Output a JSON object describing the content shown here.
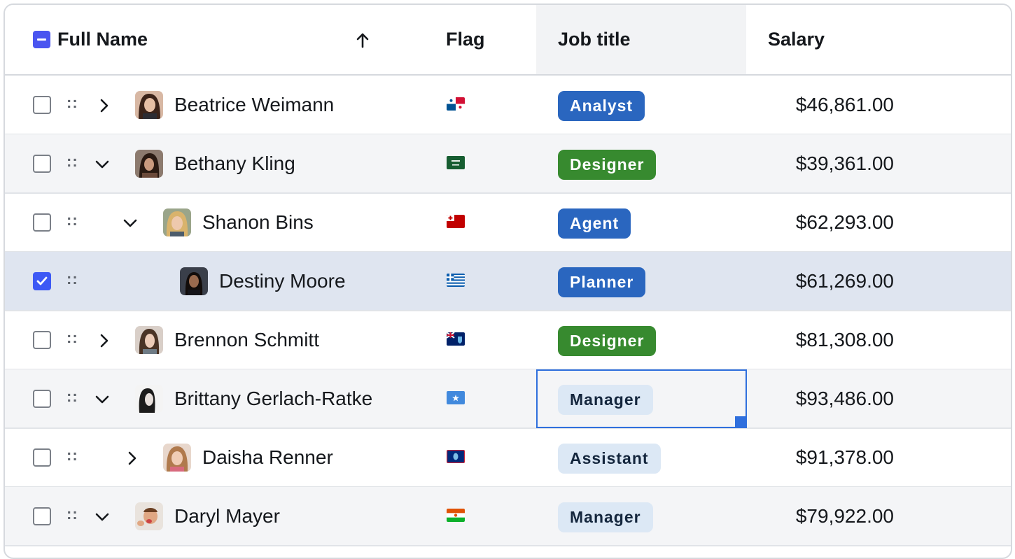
{
  "columns": {
    "full_name": "Full Name",
    "flag": "Flag",
    "job_title": "Job title",
    "salary": "Salary"
  },
  "header": {
    "select_all_state": "indeterminate",
    "sort_direction": "ascending",
    "sort_icon": "arrow-up-icon"
  },
  "rows": [
    {
      "name": "Beatrice Weimann",
      "expander": "collapsed",
      "level": 0,
      "checked": false,
      "flag": "flag-panama-icon",
      "job": "Analyst",
      "badge_style": "blue",
      "salary": "$46,861.00"
    },
    {
      "name": "Bethany Kling",
      "expander": "expanded",
      "level": 0,
      "checked": false,
      "flag": "flag-saudi-arabia-icon",
      "job": "Designer",
      "badge_style": "green",
      "salary": "$39,361.00"
    },
    {
      "name": "Shanon Bins",
      "expander": "expanded",
      "level": 1,
      "checked": false,
      "flag": "flag-tonga-icon",
      "job": "Agent",
      "badge_style": "blue",
      "salary": "$62,293.00"
    },
    {
      "name": "Destiny Moore",
      "expander": "none",
      "level": 2,
      "checked": true,
      "flag": "flag-greece-icon",
      "job": "Planner",
      "badge_style": "blue",
      "salary": "$61,269.00"
    },
    {
      "name": "Brennon Schmitt",
      "expander": "collapsed",
      "level": 0,
      "checked": false,
      "flag": "flag-saint-helena-icon",
      "job": "Designer",
      "badge_style": "green",
      "salary": "$81,308.00"
    },
    {
      "name": "Brittany Gerlach-Ratke",
      "expander": "expanded",
      "level": 0,
      "checked": false,
      "flag": "flag-somalia-icon",
      "job": "Manager",
      "badge_style": "light",
      "salary": "$93,486.00",
      "focused": true
    },
    {
      "name": "Daisha Renner",
      "expander": "collapsed",
      "level": 1,
      "checked": false,
      "flag": "flag-guam-icon",
      "job": "Assistant",
      "badge_style": "light",
      "salary": "$91,378.00"
    },
    {
      "name": "Daryl Mayer",
      "expander": "expanded",
      "level": 0,
      "checked": false,
      "flag": "flag-niger-icon",
      "job": "Manager",
      "badge_style": "light",
      "salary": "$79,922.00"
    }
  ],
  "colors": {
    "accent": "#3d59f5",
    "badge_blue": "#2a66bf",
    "badge_green": "#378a2f",
    "badge_light": "#dce8f5",
    "selected_row": "#dfe5f0",
    "alt_row": "#f4f5f7"
  }
}
